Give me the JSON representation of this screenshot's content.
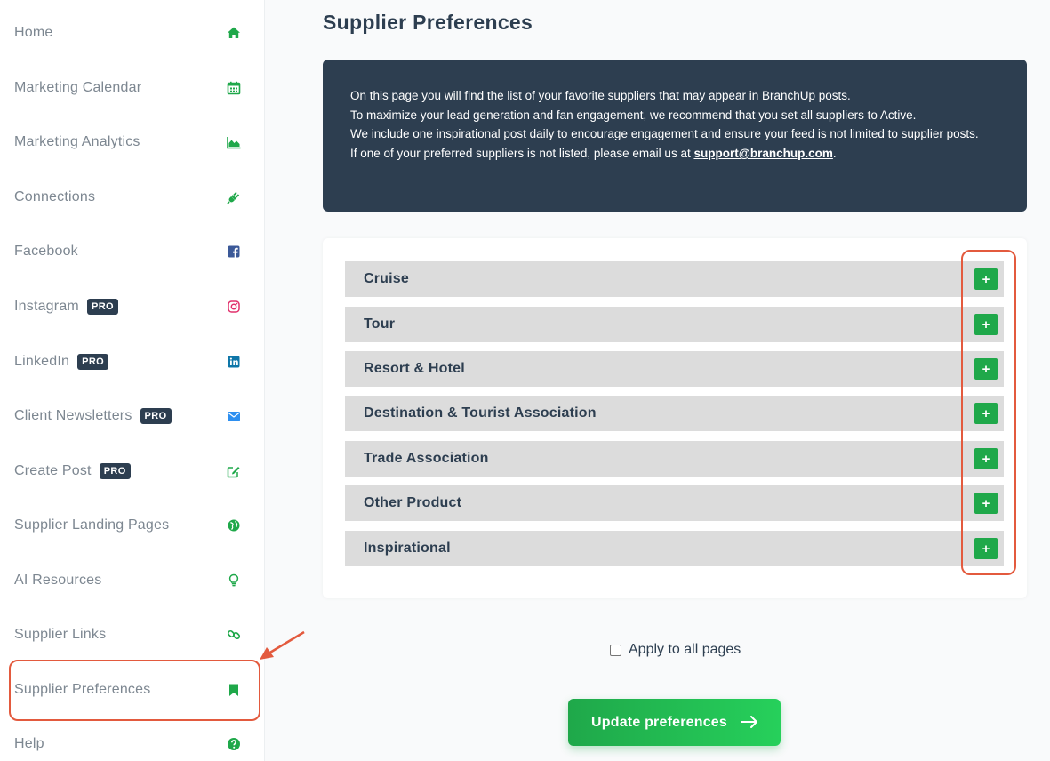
{
  "sidebar": {
    "items": [
      {
        "label": "Home",
        "icon": "home-icon",
        "pro": ""
      },
      {
        "label": "Marketing Calendar",
        "icon": "calendar-icon",
        "pro": ""
      },
      {
        "label": "Marketing Analytics",
        "icon": "chart-area-icon",
        "pro": ""
      },
      {
        "label": "Connections",
        "icon": "plug-icon",
        "pro": ""
      },
      {
        "label": "Facebook",
        "icon": "facebook-icon",
        "pro": ""
      },
      {
        "label": "Instagram",
        "icon": "instagram-icon",
        "pro": "PRO"
      },
      {
        "label": "LinkedIn",
        "icon": "linkedin-icon",
        "pro": "PRO"
      },
      {
        "label": "Client Newsletters",
        "icon": "envelope-icon",
        "pro": "PRO"
      },
      {
        "label": "Create Post",
        "icon": "edit-icon",
        "pro": "PRO"
      },
      {
        "label": "Supplier Landing Pages",
        "icon": "globe-icon",
        "pro": ""
      },
      {
        "label": "AI Resources",
        "icon": "lightbulb-icon",
        "pro": ""
      },
      {
        "label": "Supplier Links",
        "icon": "link-icon",
        "pro": ""
      },
      {
        "label": "Supplier Preferences",
        "icon": "bookmark-icon",
        "pro": ""
      },
      {
        "label": "Help",
        "icon": "question-circle-icon",
        "pro": ""
      }
    ]
  },
  "main": {
    "title": "Supplier Preferences",
    "info": {
      "line1": "On this page you will find the list of your favorite suppliers that may appear in BranchUp posts.",
      "line2": "To maximize your lead generation and fan engagement, we recommend that you set all suppliers to Active.",
      "line3": "We include one inspirational post daily to encourage engagement and ensure your feed is not limited to supplier posts.",
      "line4_prefix": "If one of your preferred suppliers is not listed, please email us at ",
      "email": "support@branchup.com",
      "line4_suffix": "."
    },
    "categories": [
      {
        "label": "Cruise"
      },
      {
        "label": "Tour"
      },
      {
        "label": "Resort & Hotel"
      },
      {
        "label": "Destination & Tourist Association"
      },
      {
        "label": "Trade Association"
      },
      {
        "label": "Other Product"
      },
      {
        "label": "Inspirational"
      }
    ],
    "expand_symbol": "+",
    "apply_label": "Apply to all pages",
    "update_label": "Update preferences"
  },
  "colors": {
    "accent_green": "#1fa84a",
    "navy": "#2d3e50",
    "annotation_red": "#e35a3e"
  }
}
